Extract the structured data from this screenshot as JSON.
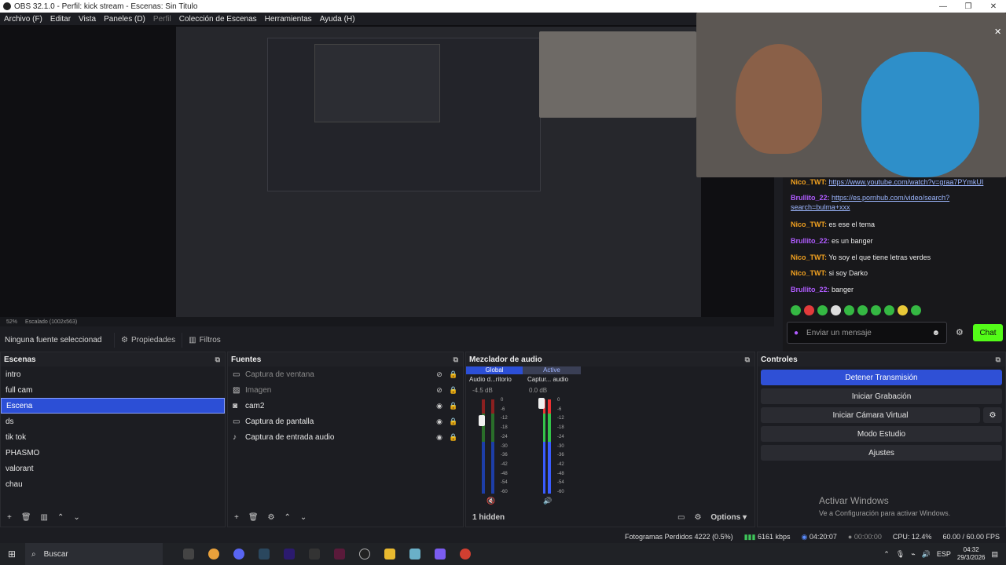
{
  "window": {
    "title": "OBS 32.1.0 - Perfil: kick stream - Escenas: Sin Titulo"
  },
  "menu": {
    "items": [
      "Archivo (F)",
      "Editar",
      "Vista",
      "Paneles (D)",
      "Perfil",
      "Colección de Escenas",
      "Herramientas",
      "Ayuda (H)"
    ]
  },
  "preview": {
    "zoom": "52%",
    "scaling": "Escalado (1002x563)"
  },
  "chat": {
    "messages": [
      {
        "user": "Nico_TWT:",
        "text": "https://www.youtube.com/watch?v=graa7PYmkUI",
        "color": "#f0a020",
        "link": true
      },
      {
        "user": "Brullito_22:",
        "text": "https://es.pornhub.com/video/search?search=bulma+xxx",
        "color": "#b05cff",
        "link": true
      },
      {
        "user": "Nico_TWT:",
        "text": "es ese el tema",
        "color": "#f0a020",
        "link": false
      },
      {
        "user": "Brullito_22:",
        "text": "es un banger",
        "color": "#b05cff",
        "link": false
      },
      {
        "user": "Nico_TWT:",
        "text": "Yo soy el que tiene letras verdes",
        "color": "#f0a020",
        "link": false
      },
      {
        "user": "Nico_TWT:",
        "text": "si soy Darko",
        "color": "#f0a020",
        "link": false
      },
      {
        "user": "Brullito_22:",
        "text": "banger",
        "color": "#b05cff",
        "link": false
      }
    ],
    "input_placeholder": "Enviar un mensaje",
    "send_label": "Chat"
  },
  "sourcebar": {
    "selection": "Ninguna fuente seleccionad",
    "properties": "Propiedades",
    "filters": "Filtros"
  },
  "scenes": {
    "title": "Escenas",
    "items": [
      "intro",
      "full cam",
      "Escena",
      "ds",
      "tik tok",
      "PHASMO",
      "valorant",
      "chau"
    ],
    "selected": 2
  },
  "sources": {
    "title": "Fuentes",
    "items": [
      {
        "name": "Captura de ventana",
        "icon": "window-icon",
        "hidden": true
      },
      {
        "name": "Imagen",
        "icon": "image-icon",
        "hidden": true
      },
      {
        "name": "cam2",
        "icon": "camera-icon",
        "hidden": false
      },
      {
        "name": "Captura de pantalla",
        "icon": "monitor-icon",
        "hidden": false
      },
      {
        "name": "Captura de entrada audio",
        "icon": "mic-icon",
        "hidden": false
      }
    ]
  },
  "mixer": {
    "title": "Mezclador de audio",
    "tab_global": "Global",
    "tab_active": "Active",
    "ch1_name": "Audio d...ritorio",
    "ch1_db": "-4.5 dB",
    "ch2_name": "Captur... audio",
    "ch2_db": "0.0 dB",
    "ticks": [
      "0",
      "-6",
      "-12",
      "-18",
      "-24",
      "-30",
      "-36",
      "-42",
      "-48",
      "-54",
      "-60"
    ],
    "hidden_label": "1 hidden",
    "options_label": "Options"
  },
  "controls": {
    "title": "Controles",
    "buttons": [
      "Detener Transmisión",
      "Iniciar Grabación",
      "Iniciar Cámara Virtual",
      "Modo Estudio",
      "Ajustes"
    ]
  },
  "watermark": {
    "line1": "Activar Windows",
    "line2": "Ve a Configuración para activar Windows."
  },
  "status": {
    "dropped": "Fotogramas Perdidos 4222 (0.5%)",
    "bitrate": "6161 kbps",
    "stream_time": "04:20:07",
    "rec_time": "00:00:00",
    "cpu": "CPU: 12.4%",
    "fps": "60.00 / 60.00 FPS"
  },
  "taskbar": {
    "search": "Buscar",
    "lang": "ESP",
    "time": "04:32",
    "date": "29/3/2026"
  },
  "colors": {
    "accent": "#2f50d6",
    "kick_green": "#53fc18"
  }
}
